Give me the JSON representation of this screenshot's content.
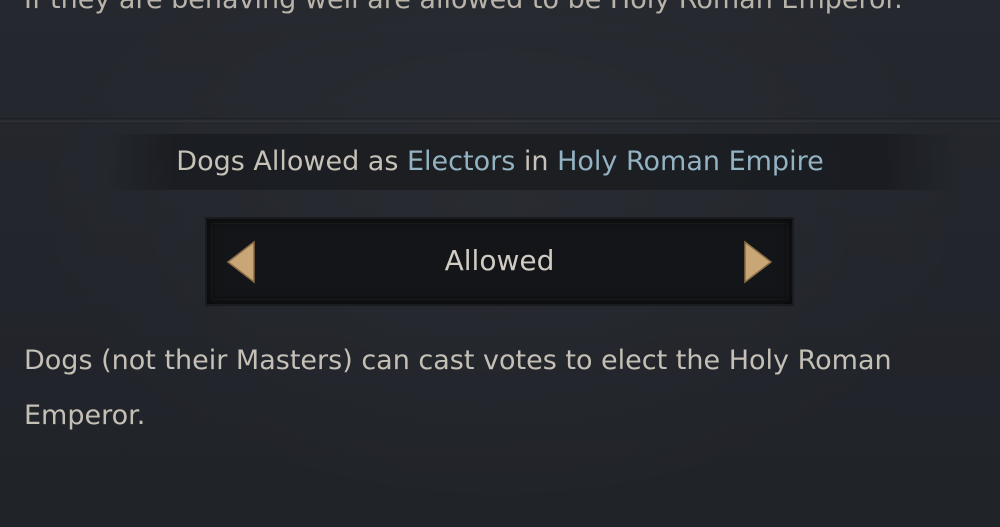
{
  "previous_text": "If they are behaving well are allowed to be Holy Roman Emperor.",
  "law": {
    "title_prefix": "Dogs Allowed as ",
    "title_link_1": "Electors",
    "title_middle": " in ",
    "title_link_2": "Holy Roman Empire"
  },
  "selector": {
    "value": "Allowed",
    "prev_icon": "chevron-left-icon",
    "next_icon": "chevron-right-icon",
    "arrow_color": "#c9a675"
  },
  "description": "Dogs (not their Masters) can cast votes to elect the Holy Roman Emperor.",
  "colors": {
    "background": "#23262c",
    "text": "#c5c0b6",
    "link": "#93b3c2"
  }
}
